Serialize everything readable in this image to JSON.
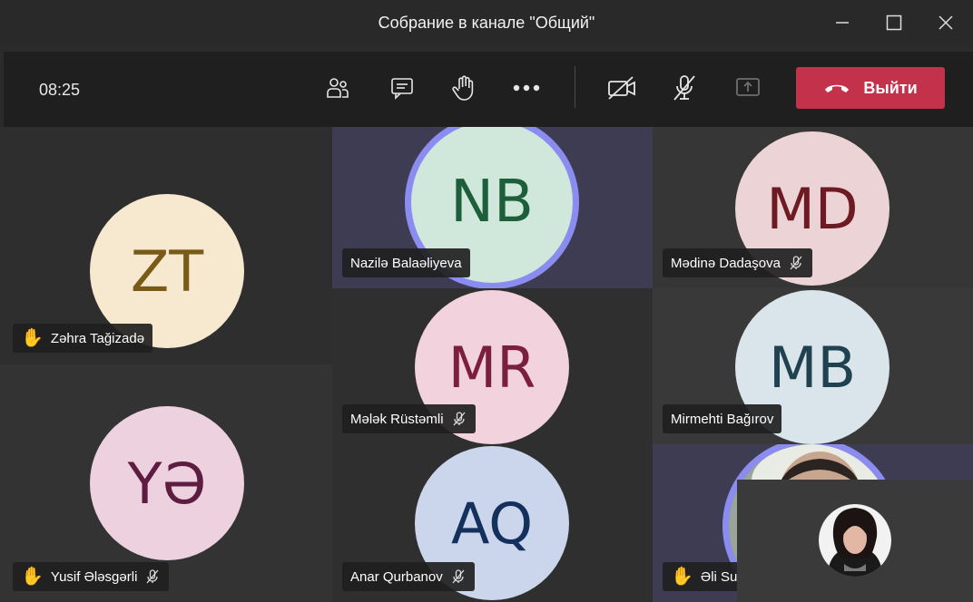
{
  "window": {
    "title": "Собрание в канале \"Общий\"",
    "minimize_icon": "minimize-icon",
    "maximize_icon": "maximize-icon",
    "close_icon": "close-icon"
  },
  "toolbar": {
    "time": "08:25",
    "icons": [
      "participants-icon",
      "chat-icon",
      "raise-hand-icon",
      "more-icon",
      "camera-off-icon",
      "mic-off-icon",
      "share-screen-icon"
    ],
    "leave_label": "Выйти",
    "leave_color": "#c4314b"
  },
  "participants": [
    {
      "initials": "ZT",
      "name": "Zəhra Tağizadə",
      "bg": "#f7e9cf",
      "fg": "#7a5a17",
      "hand_raised": true,
      "muted": false,
      "speaking": false
    },
    {
      "initials": "NB",
      "name": "Nazilə Balaəliyeva",
      "bg": "#cfe8db",
      "fg": "#1d5e3b",
      "hand_raised": false,
      "muted": false,
      "speaking": true
    },
    {
      "initials": "MD",
      "name": "Mədinə Dadaşova",
      "bg": "#ecd3d5",
      "fg": "#6e1a22",
      "hand_raised": false,
      "muted": true,
      "speaking": false
    },
    {
      "initials": "MR",
      "name": "Mələk Rüstəmli",
      "bg": "#f2d2dc",
      "fg": "#7b1f3f",
      "hand_raised": false,
      "muted": true,
      "speaking": false
    },
    {
      "initials": "MB",
      "name": "Mirmehti Bağırov",
      "bg": "#d9e5ea",
      "fg": "#1f4150",
      "hand_raised": false,
      "muted": false,
      "speaking": false
    },
    {
      "initials": "YƏ",
      "name": "Yusif Ələsgərli",
      "bg": "#eed1df",
      "fg": "#5e1d40",
      "hand_raised": true,
      "muted": true,
      "speaking": false
    },
    {
      "initials": "AQ",
      "name": "Anar Qurbanov",
      "bg": "#cbd6ec",
      "fg": "#14305d",
      "hand_raised": false,
      "muted": true,
      "speaking": false
    },
    {
      "initials": "",
      "name": "Əli Su",
      "bg": "#7a8a6a",
      "fg": "#ffffff",
      "hand_raised": true,
      "muted": false,
      "speaking": true
    }
  ],
  "colors": {
    "speaking_ring": "#8b8cf0",
    "tile_bg": "#333333"
  }
}
